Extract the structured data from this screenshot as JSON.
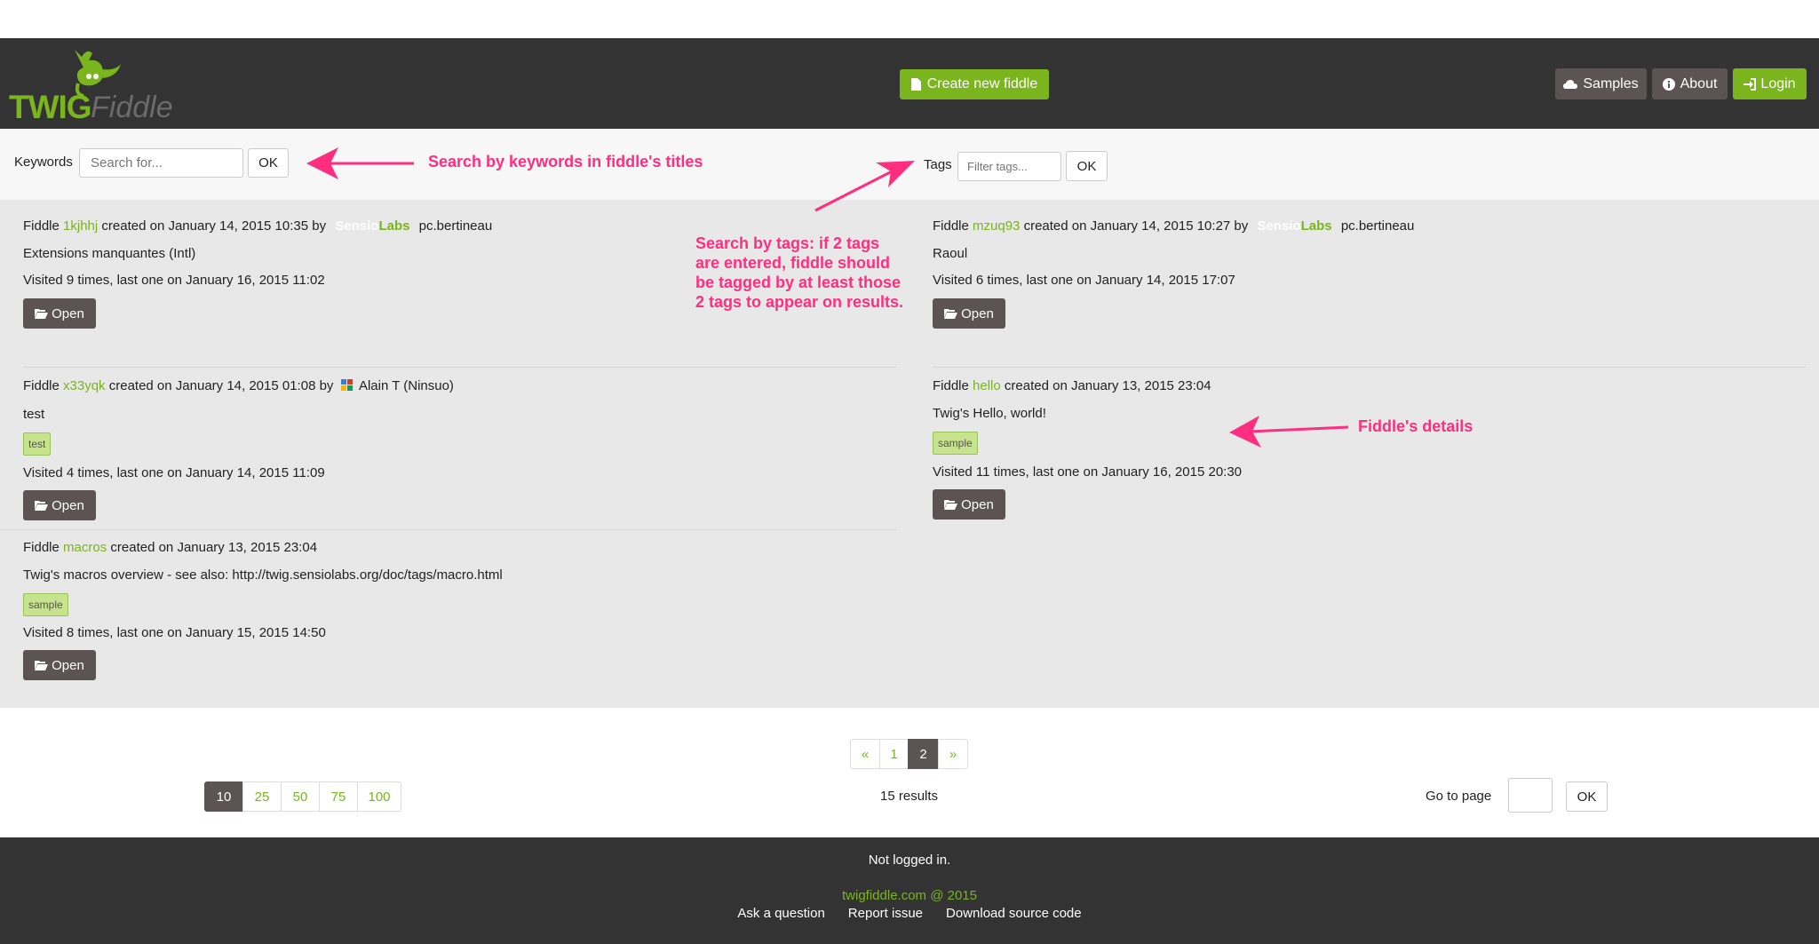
{
  "header": {
    "logo_twig": "TWIG",
    "logo_fiddle": "Fiddle",
    "create_label": "Create new fiddle",
    "samples_label": "Samples",
    "about_label": "About",
    "login_label": "Login"
  },
  "search": {
    "keywords_label": "Keywords",
    "keywords_placeholder": "Search for...",
    "keywords_ok": "OK",
    "tags_label": "Tags",
    "tags_placeholder": "Filter tags...",
    "tags_ok": "OK"
  },
  "annotations": {
    "keywords": "Search by keywords in fiddle's titles",
    "tags_lines": [
      "Search by tags: if 2 tags",
      "are entered, fiddle should",
      "be tagged by at least those",
      "2 tags to appear on results."
    ],
    "details": "Fiddle's details"
  },
  "fiddles": [
    {
      "prefix": "Fiddle",
      "id": "1kjhhj",
      "created": "created on January 14, 2015 10:35 by",
      "author_logo": [
        "Sensio",
        "Labs"
      ],
      "author": "pc.bertineau",
      "title": "Extensions manquantes (Intl)",
      "tags": [],
      "visited": "Visited 9 times, last one on January 16, 2015 11:02",
      "open": "Open"
    },
    {
      "prefix": "Fiddle",
      "id": "mzuq93",
      "created": "created on January 14, 2015 10:27 by",
      "author_logo": [
        "Sensio",
        "Labs"
      ],
      "author": "pc.bertineau",
      "title": "Raoul",
      "tags": [],
      "visited": "Visited 6 times, last one on January 14, 2015 17:07",
      "open": "Open"
    },
    {
      "prefix": "Fiddle",
      "id": "x33yqk",
      "created": "created on January 14, 2015 01:08 by",
      "author": "Alain T (Ninsuo)",
      "title": "test",
      "tags": [
        "test"
      ],
      "visited": "Visited 4 times, last one on January 14, 2015 11:09",
      "open": "Open"
    },
    {
      "prefix": "Fiddle",
      "id": "hello",
      "created": "created on January 13, 2015 23:04",
      "title": "Twig's Hello, world!",
      "tags": [
        "sample"
      ],
      "visited": "Visited 11 times, last one on January 16, 2015 20:30",
      "open": "Open"
    },
    {
      "prefix": "Fiddle",
      "id": "macros",
      "created": "created on January 13, 2015 23:04",
      "title": "Twig's macros overview - see also: http://twig.sensiolabs.org/doc/tags/macro.html",
      "tags": [
        "sample"
      ],
      "visited": "Visited 8 times, last one on January 15, 2015 14:50",
      "open": "Open"
    }
  ],
  "pagination": {
    "prev": "«",
    "pages": [
      "1",
      "2"
    ],
    "current": "2",
    "next": "»",
    "per_page": [
      "10",
      "25",
      "50",
      "75",
      "100"
    ],
    "per_page_selected": "10",
    "results": "15 results",
    "goto_label": "Go to page",
    "goto_value": "",
    "goto_ok": "OK"
  },
  "footer": {
    "status": "Not logged in.",
    "copyright": "twigfiddle.com @ 2015",
    "links": [
      "Ask a question",
      "Report issue",
      "Download source code"
    ]
  },
  "colors": {
    "accent": "#7ab51d",
    "dark": "#333333",
    "button_dark": "#5c5354",
    "annotation": "#ff2e7e",
    "tag_bg": "#c8e38d"
  }
}
